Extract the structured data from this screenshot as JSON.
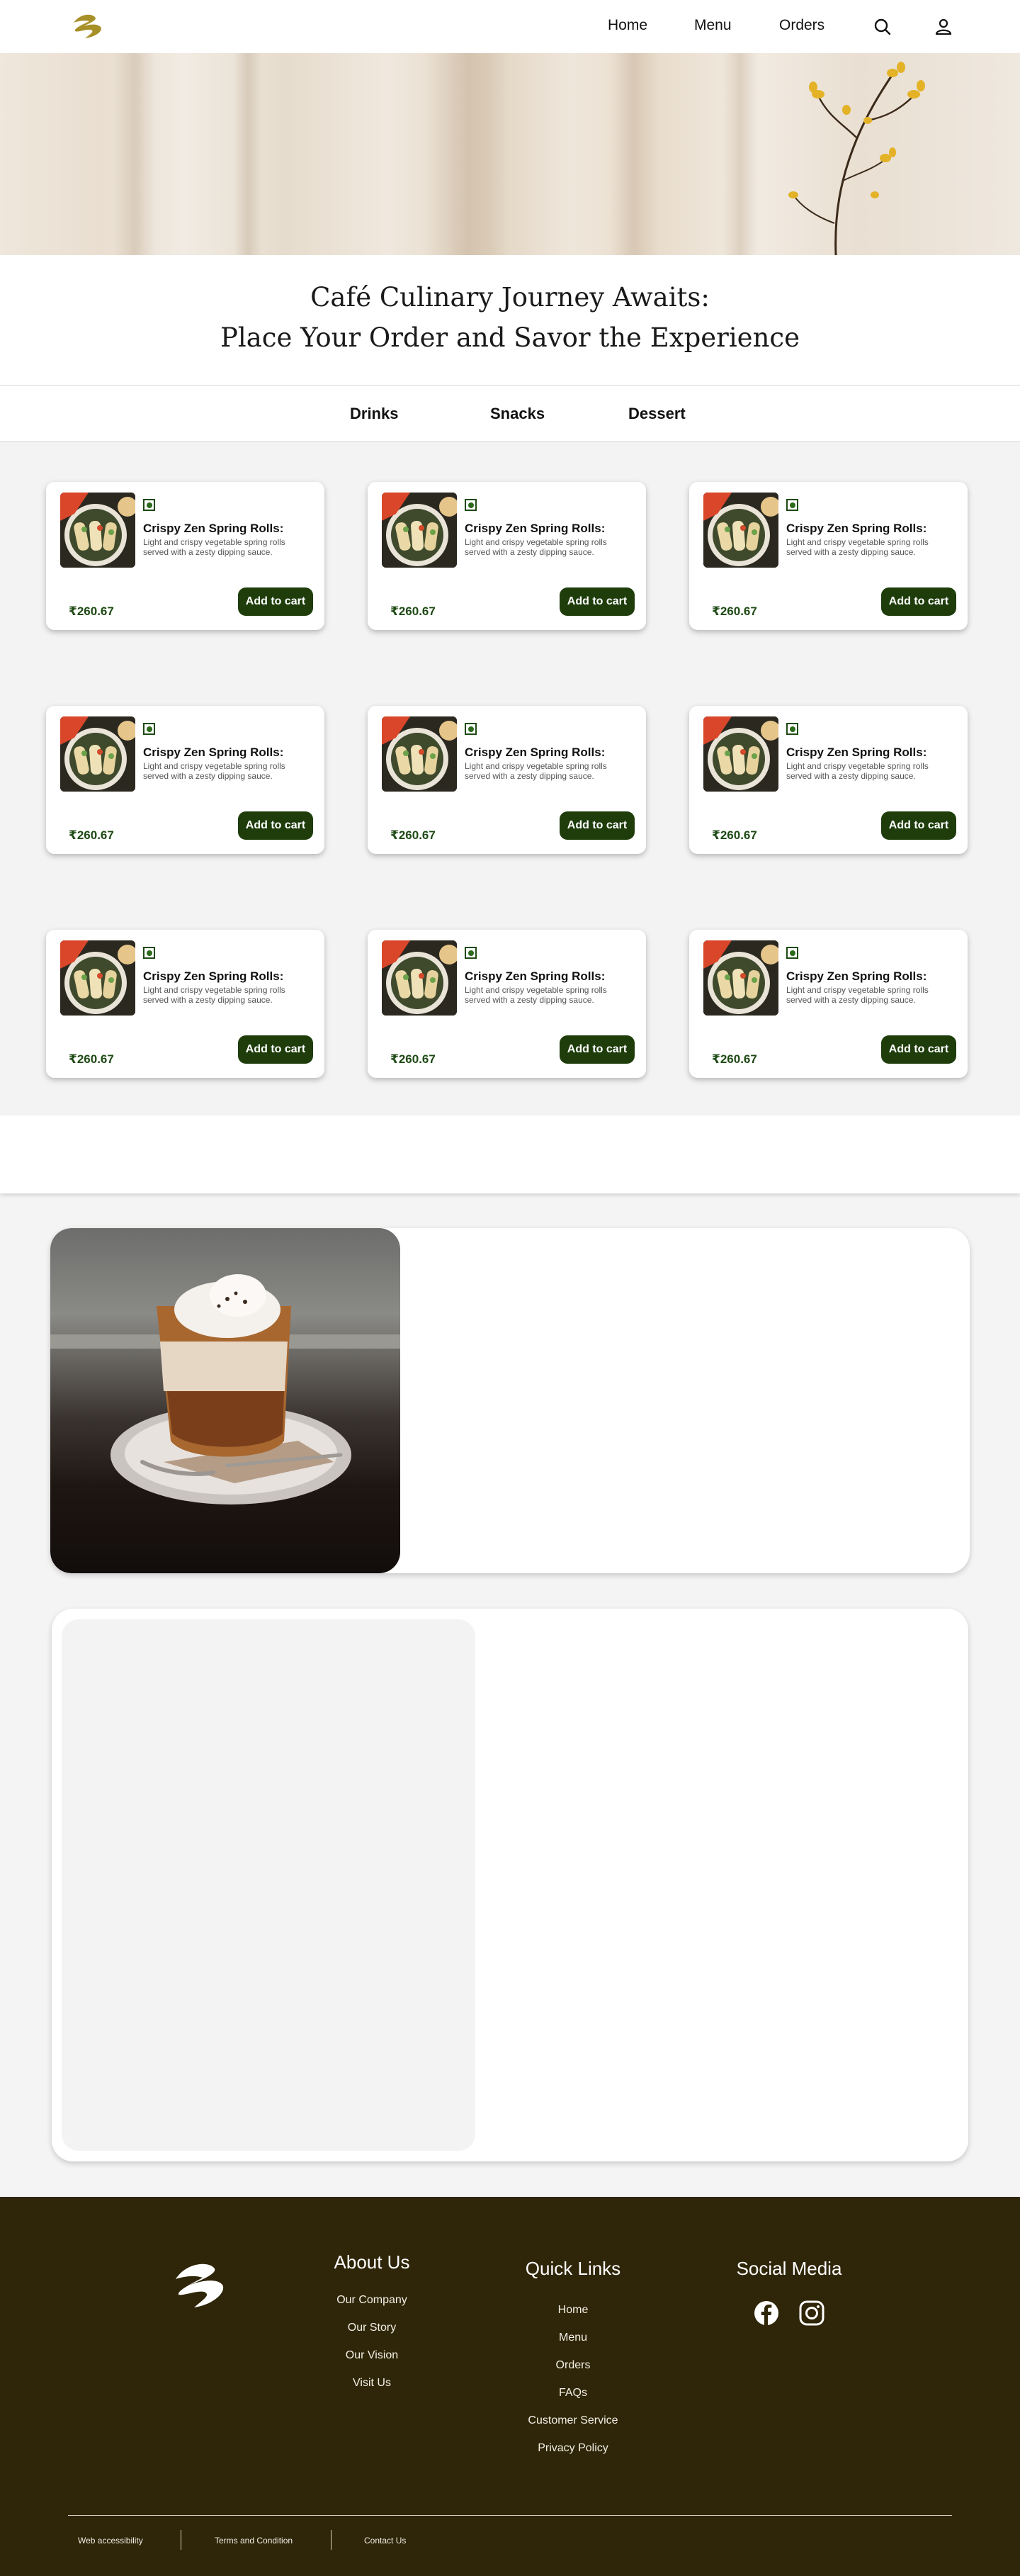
{
  "header": {
    "nav": [
      {
        "label": "Home"
      },
      {
        "label": "Menu"
      },
      {
        "label": "Orders"
      }
    ],
    "icons": [
      "logo",
      "search-icon",
      "user-icon"
    ]
  },
  "title": {
    "line1": "Café Culinary Journey Awaits:",
    "line2": "Place Your Order and Savor the Experience"
  },
  "categories": [
    "Drinks",
    "Snacks",
    "Dessert"
  ],
  "products": [
    {
      "name": "Crispy Zen Spring Rolls:",
      "description": "Light and crispy vegetable spring rolls served with a zesty dipping sauce.",
      "price": "₹260.67",
      "button": "Add to cart"
    },
    {
      "name": "Crispy Zen Spring Rolls:",
      "description": "Light and crispy vegetable spring rolls served with a zesty dipping sauce.",
      "price": "₹260.67",
      "button": "Add to cart"
    },
    {
      "name": "Crispy Zen Spring Rolls:",
      "description": "Light and crispy vegetable spring rolls served with a zesty dipping sauce.",
      "price": "₹260.67",
      "button": "Add to cart"
    },
    {
      "name": "Crispy Zen Spring Rolls:",
      "description": "Light and crispy vegetable spring rolls served with a zesty dipping sauce.",
      "price": "₹260.67",
      "button": "Add to cart"
    },
    {
      "name": "Crispy Zen Spring Rolls:",
      "description": "Light and crispy vegetable spring rolls served with a zesty dipping sauce.",
      "price": "₹260.67",
      "button": "Add to cart"
    },
    {
      "name": "Crispy Zen Spring Rolls:",
      "description": "Light and crispy vegetable spring rolls served with a zesty dipping sauce.",
      "price": "₹260.67",
      "button": "Add to cart"
    },
    {
      "name": "Crispy Zen Spring Rolls:",
      "description": "Light and crispy vegetable spring rolls served with a zesty dipping sauce.",
      "price": "₹260.67",
      "button": "Add to cart"
    },
    {
      "name": "Crispy Zen Spring Rolls:",
      "description": "Light and crispy vegetable spring rolls served with a zesty dipping sauce.",
      "price": "₹260.67",
      "button": "Add to cart"
    },
    {
      "name": "Crispy Zen Spring Rolls:",
      "description": "Light and crispy vegetable spring rolls served with a zesty dipping sauce.",
      "price": "₹260.67",
      "button": "Add to cart"
    }
  ],
  "footer": {
    "about": {
      "heading": "About Us",
      "links": [
        "Our Company",
        "Our Story",
        "Our Vision",
        "Visit Us"
      ]
    },
    "quick": {
      "heading": "Quick Links",
      "links": [
        "Home",
        "Menu",
        "Orders",
        "FAQs",
        "Customer Service",
        "Privacy Policy"
      ]
    },
    "social": {
      "heading": "Social Media",
      "icons": [
        "facebook-icon",
        "instagram-icon"
      ]
    },
    "bottom": [
      "Web accessibility",
      "Terms and Condition",
      "Contact Us"
    ]
  },
  "colors": {
    "accent_green": "#1e3d0b",
    "footer_bg": "#2f2508",
    "logo_gold": "#a89028"
  }
}
